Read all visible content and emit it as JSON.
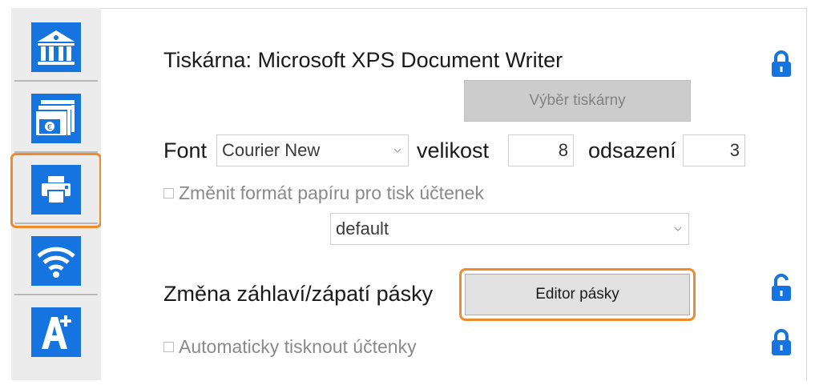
{
  "sidebar": {
    "items": [
      {
        "icon": "bank-icon",
        "active": false
      },
      {
        "icon": "cash-register-icon",
        "active": false
      },
      {
        "icon": "printer-icon",
        "active": true
      },
      {
        "icon": "wifi-icon",
        "active": false
      },
      {
        "icon": "font-plus-icon",
        "active": false
      }
    ]
  },
  "printer": {
    "title": "Tiskárna: Microsoft XPS Document Writer",
    "select_button": "Výběr tiskárny",
    "font_label": "Font",
    "font_value": "Courier New",
    "size_label": "velikost",
    "size_value": "8",
    "indent_label": "odsazení",
    "indent_value": "3",
    "paper_checkbox": "Změnit formát papíru pro tisk účtenek",
    "paper_value": "default",
    "header_footer_label": "Změna záhlaví/zápatí pásky",
    "editor_button": "Editor pásky",
    "auto_print_checkbox": "Automaticky tisknout účtenky"
  },
  "colors": {
    "accent_blue": "#1674e0",
    "highlight_orange": "#ef8b2d",
    "lock_blue": "#1674e0"
  }
}
